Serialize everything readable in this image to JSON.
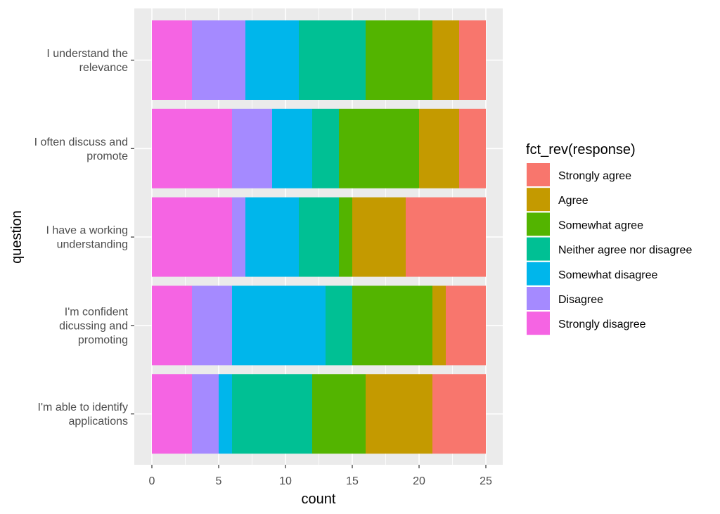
{
  "chart_data": {
    "type": "bar",
    "orientation": "horizontal",
    "stacked": true,
    "title": "",
    "xlabel": "count",
    "ylabel": "question",
    "xlim": [
      0,
      25
    ],
    "xticks": [
      0,
      5,
      10,
      15,
      20,
      25
    ],
    "xtick_labels": [
      "0",
      "5",
      "10",
      "15",
      "20",
      "25"
    ],
    "grid": true,
    "legend_position": "right",
    "legend_title": "fct_rev(response)",
    "categories": [
      "I understand the relevance",
      "I often discuss and promote",
      "I have a working understanding",
      "I'm confident dicussing and promoting",
      "I'm able to identify applications"
    ],
    "category_label_lines": [
      [
        "I understand the",
        "relevance"
      ],
      [
        "I often discuss and",
        "promote"
      ],
      [
        "I have a working",
        "understanding"
      ],
      [
        "I'm confident",
        "dicussing and",
        "promoting"
      ],
      [
        "I'm able to identify",
        "applications"
      ]
    ],
    "series": [
      {
        "name": "Strongly disagree",
        "color": "#F564E3",
        "values": [
          3,
          6,
          6,
          3,
          3
        ]
      },
      {
        "name": "Disagree",
        "color": "#A58AFF",
        "values": [
          4,
          3,
          1,
          3,
          2
        ]
      },
      {
        "name": "Somewhat disagree",
        "color": "#00B6EB",
        "values": [
          4,
          3,
          4,
          7,
          1
        ]
      },
      {
        "name": "Neither agree nor disagree",
        "color": "#00C094",
        "values": [
          5,
          2,
          3,
          2,
          6
        ]
      },
      {
        "name": "Somewhat agree",
        "color": "#53B400",
        "values": [
          5,
          6,
          1,
          6,
          4
        ]
      },
      {
        "name": "Agree",
        "color": "#C49A00",
        "values": [
          2,
          3,
          4,
          1,
          5
        ]
      },
      {
        "name": "Strongly agree",
        "color": "#F8766D",
        "values": [
          2,
          2,
          6,
          3,
          4
        ]
      }
    ],
    "legend_order": [
      "Strongly agree",
      "Agree",
      "Somewhat agree",
      "Neither agree nor disagree",
      "Somewhat disagree",
      "Disagree",
      "Strongly disagree"
    ]
  }
}
